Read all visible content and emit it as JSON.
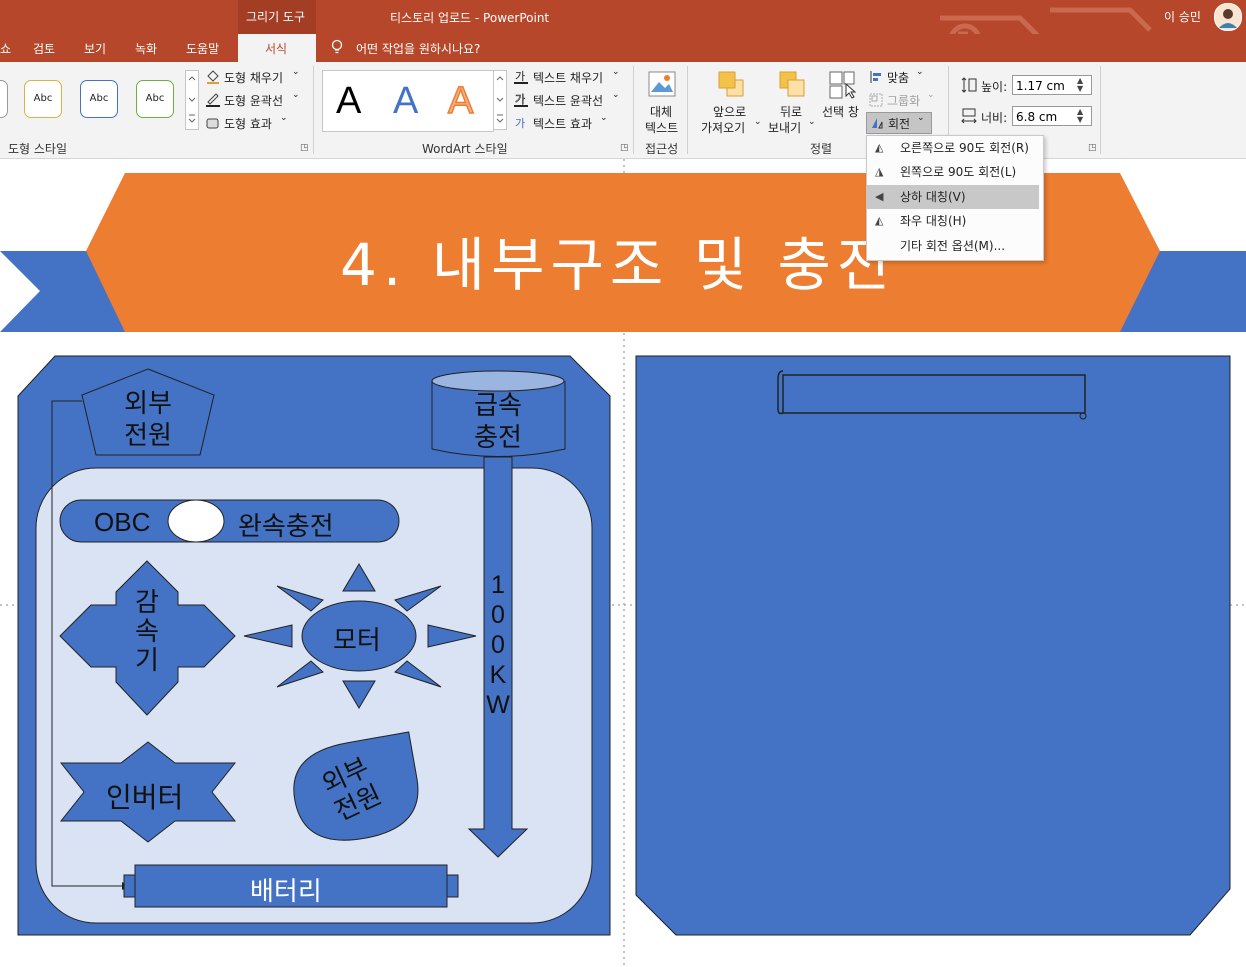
{
  "window": {
    "title": "티스토리 업로드  -  PowerPoint",
    "contextual_group": "그리기 도구",
    "user": "이 승민"
  },
  "tabs": [
    {
      "label": "쇼"
    },
    {
      "label": "검토"
    },
    {
      "label": "보기"
    },
    {
      "label": "녹화"
    },
    {
      "label": "도움말"
    },
    {
      "label": "서식"
    }
  ],
  "tell_me": "어떤 작업을 원하시나요?",
  "ribbon": {
    "shape_styles": {
      "abc_sample": "Abc",
      "fill": "도형 채우기",
      "outline": "도형 윤곽선",
      "effects": "도형 효과",
      "group_label": "도형 스타일"
    },
    "wordart": {
      "letter": "A",
      "text_fill": "텍스트 채우기",
      "text_outline": "텍스트 윤곽선",
      "text_effects": "텍스트 효과",
      "group_label": "WordArt 스타일"
    },
    "accessibility": {
      "alt_text_1": "대체",
      "alt_text_2": "텍스트",
      "group_label": "접근성"
    },
    "arrange": {
      "bring_forward_1": "앞으로",
      "bring_forward_2": "가져오기",
      "send_backward_1": "뒤로",
      "send_backward_2": "보내기",
      "selection_pane": "선택 창",
      "align": "맞춤",
      "group": "그룹화",
      "rotate": "회전",
      "group_label": "정렬"
    },
    "size": {
      "height_label": "높이:",
      "height_value": "1.17 cm",
      "width_label": "너비:",
      "width_value": "6.8 cm"
    }
  },
  "rotate_menu": [
    {
      "label": "오른쪽으로 90도 회전(R)"
    },
    {
      "label": "왼쪽으로 90도 회전(L)"
    },
    {
      "label": "상하 대칭(V)"
    },
    {
      "label": "좌우 대칭(H)"
    },
    {
      "label": "기타 회전 옵션(M)..."
    }
  ],
  "slide": {
    "title": "4. 내부구조 및 충전",
    "shapes": {
      "external_power_top": [
        "외부",
        "전원"
      ],
      "fast_charge": [
        "급속",
        "충전"
      ],
      "obc": "OBC",
      "slow_charge": "완속충전",
      "reducer": [
        "감",
        "속",
        "기"
      ],
      "motor": "모터",
      "power_100kw": [
        "1",
        "0",
        "0",
        "K",
        "W"
      ],
      "inverter": "인버터",
      "external_power_drop": [
        "외부",
        "전원"
      ],
      "battery": "배터리"
    }
  },
  "colors": {
    "titlebar": "#b7472a",
    "slide_blue": "#4472c4",
    "slide_orange": "#ed7d31",
    "inner_panel": "#dae3f3"
  }
}
